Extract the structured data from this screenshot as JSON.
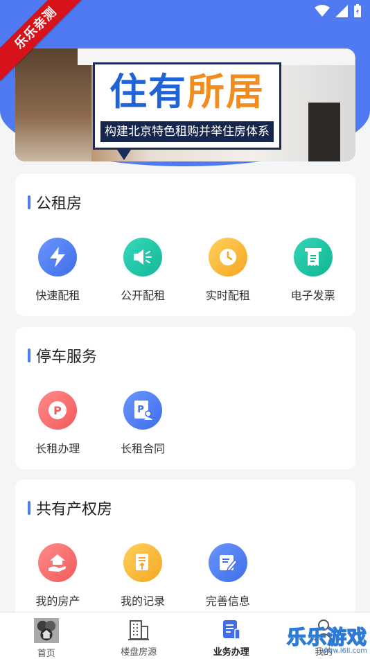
{
  "corner_badge": "乐乐亲测",
  "banner": {
    "title_part1": "住有",
    "title_part2": "所居",
    "subtitle": "构建北京特色租购并举住房体系"
  },
  "sections": [
    {
      "title": "公租房",
      "items": [
        {
          "label": "快速配租",
          "icon": "lightning-icon",
          "color": "#4f7af2"
        },
        {
          "label": "公开配租",
          "icon": "megaphone-icon",
          "color": "#1fc7a8"
        },
        {
          "label": "实时配租",
          "icon": "clock-icon",
          "color": "#f7b52b"
        },
        {
          "label": "电子发票",
          "icon": "receipt-icon",
          "color": "#19c4a5"
        }
      ]
    },
    {
      "title": "停车服务",
      "items": [
        {
          "label": "长租办理",
          "icon": "parking-icon",
          "color": "#f36c6c"
        },
        {
          "label": "长租合同",
          "icon": "parking-contract-icon",
          "color": "#4f7af2"
        }
      ]
    },
    {
      "title": "共有产权房",
      "items": [
        {
          "label": "我的房产",
          "icon": "house-hand-icon",
          "color": "#f36c6c"
        },
        {
          "label": "我的记录",
          "icon": "document-icon",
          "color": "#f7b52b"
        },
        {
          "label": "完善信息",
          "icon": "edit-form-icon",
          "color": "#4f7af2"
        }
      ]
    }
  ],
  "bottom_nav": [
    {
      "label": "首页",
      "icon": "home-icon",
      "active": false
    },
    {
      "label": "楼盘房源",
      "icon": "building-icon",
      "active": false
    },
    {
      "label": "业务办理",
      "icon": "business-icon",
      "active": true
    },
    {
      "label": "我的",
      "icon": "user-icon",
      "active": false
    }
  ],
  "watermark": {
    "main": "乐乐游戏",
    "url": "www.l6ll.com"
  },
  "colors": {
    "accent": "#4f7af2",
    "background": "#f4f5f7"
  }
}
